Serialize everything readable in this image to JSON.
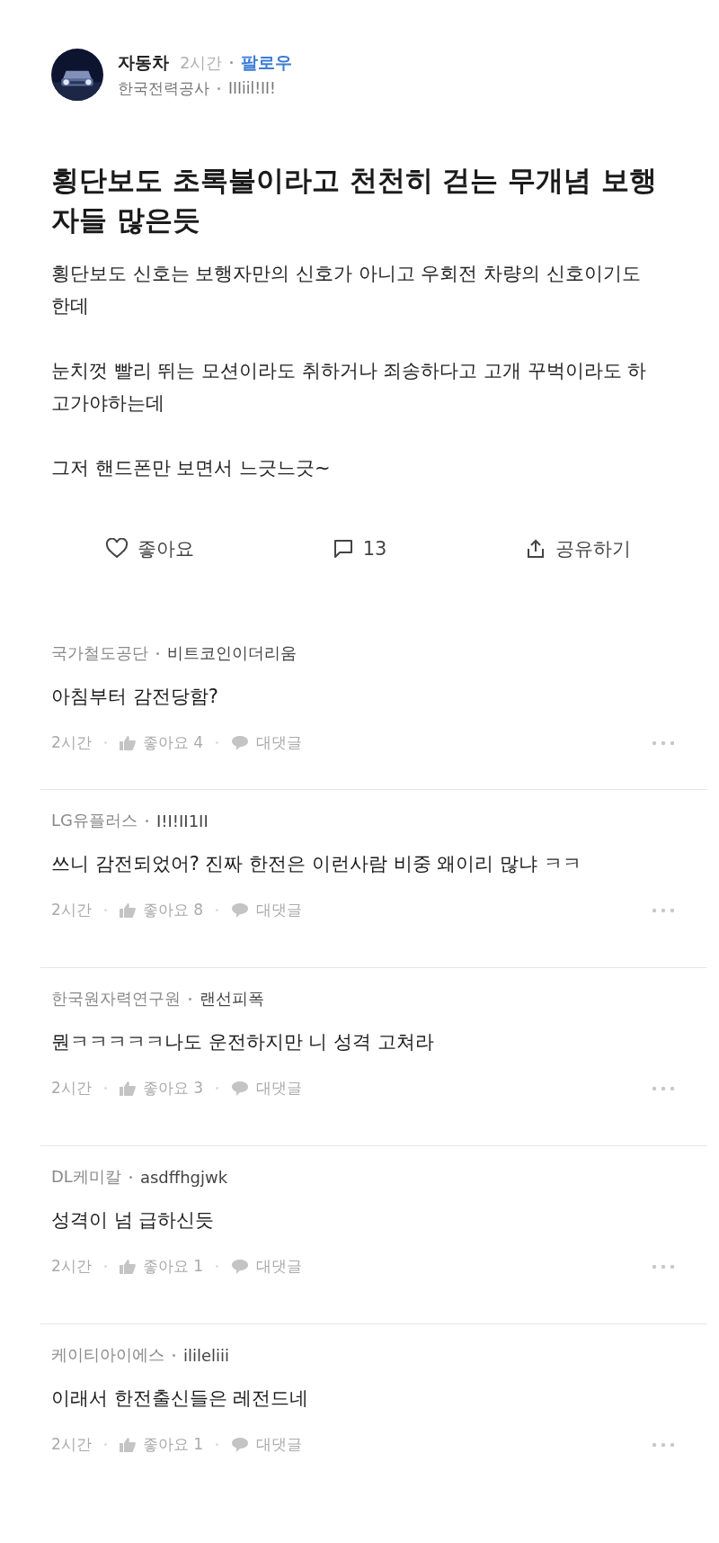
{
  "post": {
    "author": "자동차",
    "time": "2시간",
    "follow": "팔로우",
    "company": "한국전력공사",
    "nickname": "IIIiil!II!",
    "title": "횡단보도 초록불이라고 천천히 걷는 무개념 보행자들 많은듯",
    "paragraphs": [
      "횡단보도 신호는 보행자만의 신호가 아니고 우회전 차량의 신호이기도 한데",
      "눈치껏 빨리 뛰는 모션이라도 취하거나 죄송하다고 고개 꾸벅이라도 하고가야하는데",
      "그저 핸드폰만 보면서 느긋느긋~"
    ]
  },
  "actions": {
    "like": "좋아요",
    "comments": "13",
    "share": "공유하기"
  },
  "comments": [
    {
      "company": "국가철도공단",
      "nickname": "비트코인이더리움",
      "text": "아침부터 감전당함?",
      "time": "2시간",
      "likes": "좋아요 4",
      "reply": "대댓글"
    },
    {
      "company": "LG유플러스",
      "nickname": "I!I!II1II",
      "text": "쓰니 감전되었어? 진짜 한전은 이런사람 비중 왜이리 많냐 ㅋㅋ",
      "time": "2시간",
      "likes": "좋아요 8",
      "reply": "대댓글"
    },
    {
      "company": "한국원자력연구원",
      "nickname": "랜선피폭",
      "text": "뭔ㅋㅋㅋㅋㅋ나도 운전하지만 니 성격 고쳐라",
      "time": "2시간",
      "likes": "좋아요 3",
      "reply": "대댓글"
    },
    {
      "company": "DL케미칼",
      "nickname": "asdffhgjwk",
      "text": "성격이 넘 급하신듯",
      "time": "2시간",
      "likes": "좋아요 1",
      "reply": "대댓글"
    },
    {
      "company": "케이티아이에스",
      "nickname": "ilileliii",
      "text": "이래서 한전출신들은 레전드네",
      "time": "2시간",
      "likes": "좋아요 1",
      "reply": "대댓글"
    }
  ]
}
